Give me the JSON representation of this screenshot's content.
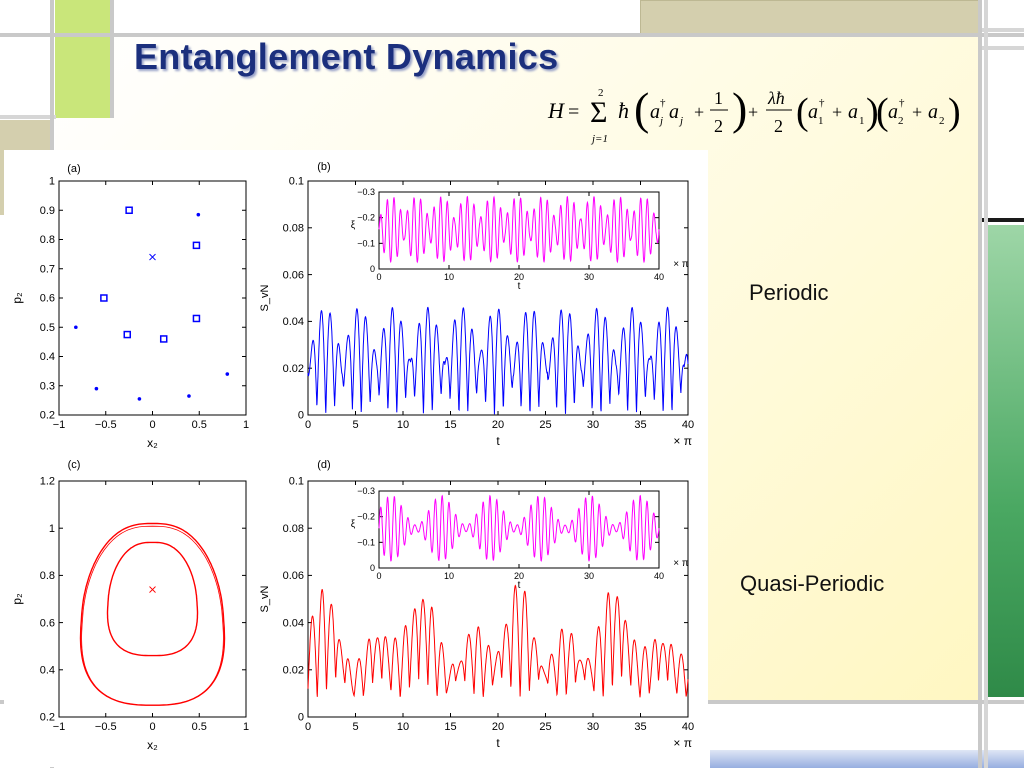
{
  "slide": {
    "title": "Entanglement Dynamics",
    "labels": {
      "periodic": "Periodic",
      "quasi": "Quasi-Periodic"
    },
    "equation": {
      "lhs": "H",
      "sum_upper": "2",
      "sum_lower": "j=1",
      "hbar": "ħ",
      "op_a": "a",
      "dagger": "†",
      "index_j": "j",
      "half_num": "1",
      "half_den": "2",
      "coupling_num": "λħ",
      "coupling_den": "2",
      "index_1": "1",
      "index_2": "2"
    }
  },
  "colors": {
    "title": "#1b2f7d",
    "green_bar": "#3e9a5a",
    "lime_block": "#c9e67a",
    "tan_block": "#d4cfae",
    "blue_series": "#0000ff",
    "red_series": "#ff0000",
    "magenta_series": "#ff00ff"
  },
  "chart_data": [
    {
      "panel": "(a)",
      "type": "scatter",
      "xlabel": "x₂",
      "ylabel": "p₂",
      "xlim": [
        -1,
        1
      ],
      "ylim": [
        0.2,
        1
      ],
      "xticks": [
        "−1",
        "−0.5",
        "0",
        "0.5",
        "1"
      ],
      "yticks": [
        "0.2",
        "0.3",
        "0.4",
        "0.5",
        "0.6",
        "0.7",
        "0.8",
        "0.9",
        "1"
      ],
      "center_marker": {
        "x": 0,
        "y": 0.74,
        "symbol": "x"
      },
      "squares": [
        [
          -0.25,
          0.9
        ],
        [
          0.47,
          0.78
        ],
        [
          -0.52,
          0.6
        ],
        [
          0.47,
          0.53
        ],
        [
          -0.27,
          0.475
        ],
        [
          0.12,
          0.46
        ]
      ],
      "dots": [
        [
          0.49,
          0.885
        ],
        [
          -0.82,
          0.5
        ],
        [
          -0.6,
          0.29
        ],
        [
          -0.14,
          0.255
        ],
        [
          0.39,
          0.265
        ],
        [
          0.8,
          0.34
        ]
      ]
    },
    {
      "panel": "(b)",
      "type": "line",
      "xlabel": "t",
      "ylabel": "S_vN",
      "x_unit": "× π",
      "xlim": [
        0,
        40
      ],
      "ylim": [
        0,
        0.1
      ],
      "xticks": [
        "0",
        "5",
        "10",
        "15",
        "20",
        "25",
        "30",
        "35",
        "40"
      ],
      "yticks": [
        "0",
        "0.02",
        "0.04",
        "0.06",
        "0.08",
        "0.1"
      ],
      "series": [
        {
          "color": "#0000ff",
          "kind": "periodic",
          "peak": 0.046,
          "min": 0.0
        }
      ],
      "inset": {
        "ylabel": "ξ",
        "x_unit": "× π",
        "xlabel": "t",
        "xlim": [
          0,
          40
        ],
        "ylim": [
          -0.33,
          0
        ],
        "xticks": [
          "0",
          "10",
          "20",
          "30",
          "40"
        ],
        "yticks": [
          "0",
          "−0.1",
          "−0.2",
          "−0.3"
        ],
        "series": [
          {
            "color": "#ff00ff",
            "kind": "periodic",
            "max": -0.02,
            "min": -0.3
          }
        ]
      }
    },
    {
      "panel": "(c)",
      "type": "line",
      "xlabel": "x₂",
      "ylabel": "p₂",
      "xlim": [
        -1,
        1
      ],
      "ylim": [
        0.2,
        1.2
      ],
      "xticks": [
        "−1",
        "−0.5",
        "0",
        "0.5",
        "1"
      ],
      "yticks": [
        "0.2",
        "0.4",
        "0.6",
        "0.8",
        "1",
        "1.2"
      ],
      "center_marker": {
        "x": 0,
        "y": 0.74,
        "symbol": "x"
      },
      "series": [
        {
          "name": "",
          "color": "#ff0000",
          "outer": true,
          "top": 1.02,
          "bottom": 0.25,
          "left": -0.88,
          "right": 0.88
        },
        {
          "name": "",
          "color": "#ff0000",
          "outer": false,
          "top": 0.94,
          "bottom": 0.46,
          "left": -0.55,
          "right": 0.55
        }
      ]
    },
    {
      "panel": "(d)",
      "type": "line",
      "xlabel": "t",
      "ylabel": "S_vN",
      "x_unit": "× π",
      "xlim": [
        0,
        40
      ],
      "ylim": [
        0,
        0.1
      ],
      "xticks": [
        "0",
        "5",
        "10",
        "15",
        "20",
        "25",
        "30",
        "35",
        "40"
      ],
      "yticks": [
        "0",
        "0.02",
        "0.04",
        "0.06",
        "0.08",
        "0.1"
      ],
      "series": [
        {
          "color": "#ff0000",
          "kind": "quasi-periodic",
          "peak": 0.054,
          "min": 0.0
        }
      ],
      "inset": {
        "ylabel": "ξ",
        "x_unit": "× π",
        "xlabel": "t",
        "xlim": [
          0,
          40
        ],
        "ylim": [
          -0.33,
          0
        ],
        "xticks": [
          "0",
          "10",
          "20",
          "30",
          "40"
        ],
        "yticks": [
          "0",
          "−0.1",
          "−0.2",
          "−0.3"
        ],
        "series": [
          {
            "color": "#ff00ff",
            "kind": "quasi-periodic",
            "max": -0.02,
            "min": -0.3
          }
        ]
      }
    }
  ]
}
